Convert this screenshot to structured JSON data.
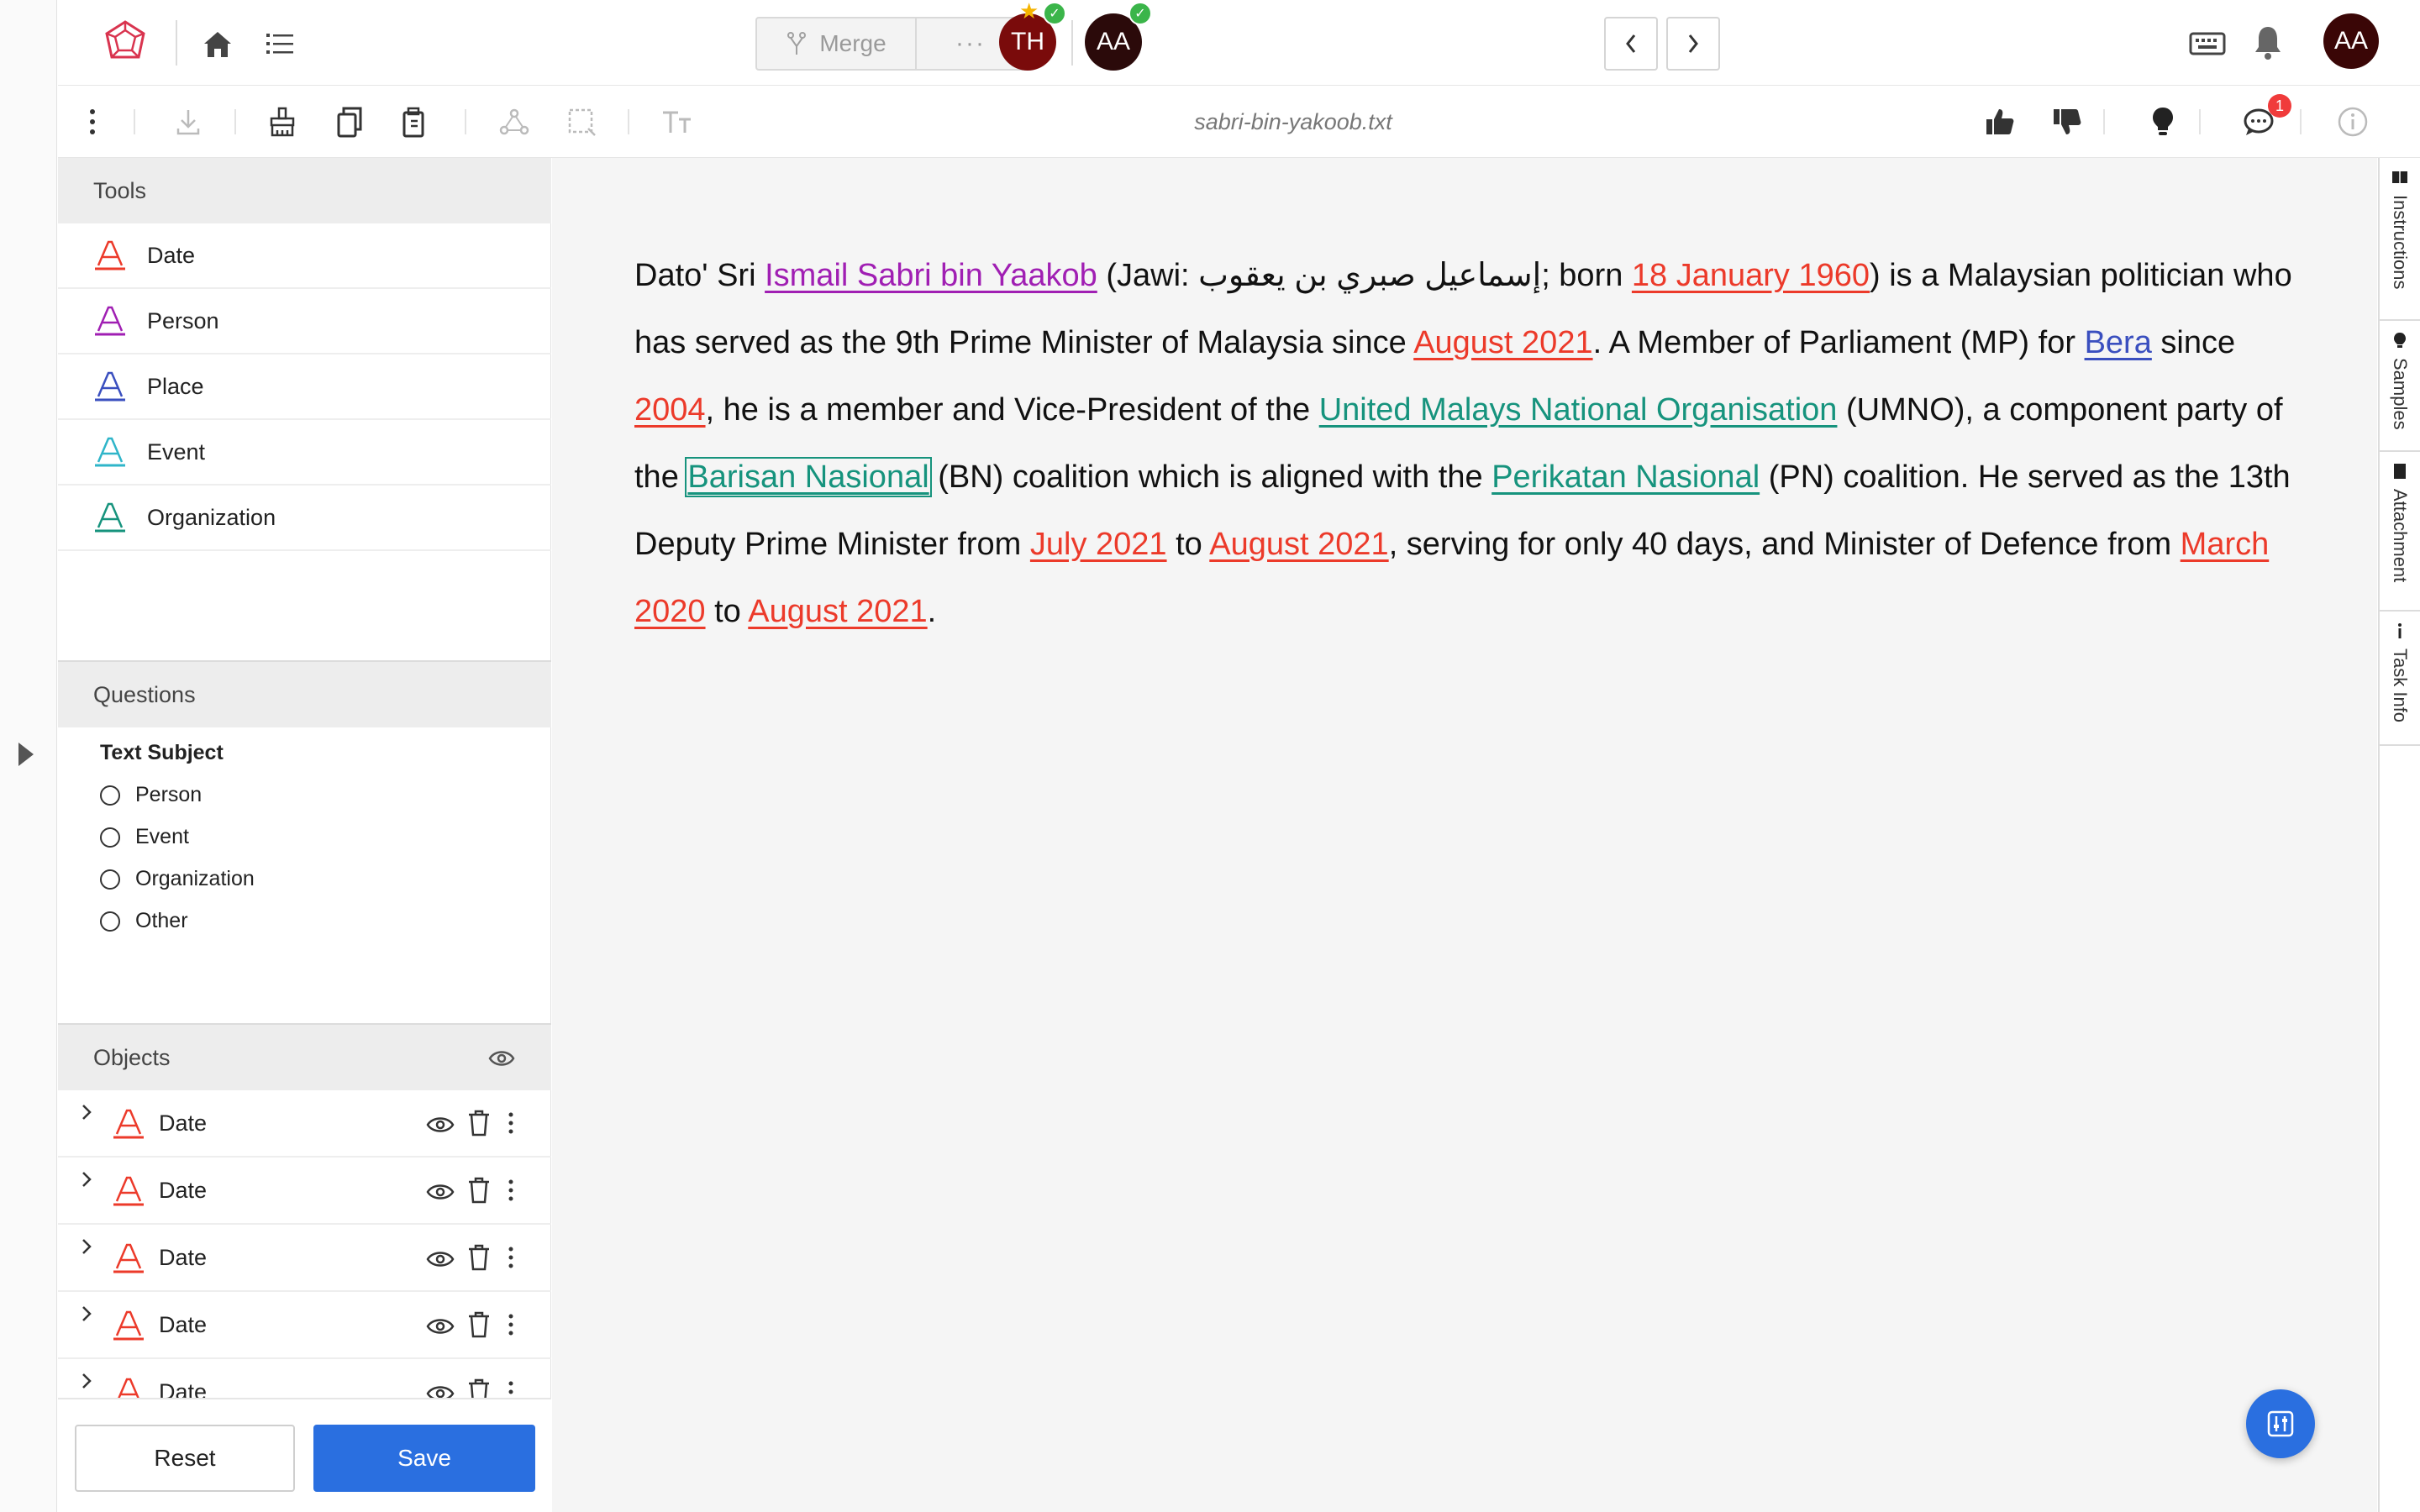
{
  "topbar": {
    "merge_label": "Merge",
    "merge_more": "···",
    "avatars": [
      "TH",
      "AA"
    ],
    "user_avatar": "AA"
  },
  "toolbar": {
    "filename": "sabri-bin-yakoob.txt",
    "comments_badge": "1"
  },
  "sidebar": {
    "tools_title": "Tools",
    "tools": [
      {
        "label": "Date",
        "color": "#ec3a2a"
      },
      {
        "label": "Person",
        "color": "#a01fb3"
      },
      {
        "label": "Place",
        "color": "#3a4fbf"
      },
      {
        "label": "Event",
        "color": "#2fb5c9"
      },
      {
        "label": "Organization",
        "color": "#16937d"
      }
    ],
    "questions_title": "Questions",
    "question": {
      "title": "Text Subject",
      "options": [
        "Person",
        "Event",
        "Organization",
        "Other"
      ]
    },
    "objects_title": "Objects",
    "objects": [
      {
        "label": "Date"
      },
      {
        "label": "Date"
      },
      {
        "label": "Date"
      },
      {
        "label": "Date"
      },
      {
        "label": "Date"
      }
    ],
    "reset_label": "Reset",
    "save_label": "Save"
  },
  "document": {
    "segments": [
      {
        "text": "Dato' Sri "
      },
      {
        "text": "Ismail Sabri bin Yaakob",
        "type": "person"
      },
      {
        "text": " (Jawi: إسماعيل صبري بن يعقوب; born "
      },
      {
        "text": "18 January 1960",
        "type": "date"
      },
      {
        "text": ") is a Malaysian politician who has served as the 9th Prime Minister of Malaysia since "
      },
      {
        "text": "August 2021",
        "type": "date"
      },
      {
        "text": ". A Member of Parliament (MP) for "
      },
      {
        "text": "Bera",
        "type": "place"
      },
      {
        "text": " since "
      },
      {
        "text": "2004",
        "type": "date"
      },
      {
        "text": ", he is a member and Vice-President of the "
      },
      {
        "text": "United Malays National Organisation",
        "type": "org"
      },
      {
        "text": " (UMNO), a component party of the "
      },
      {
        "text": "Barisan Nasional",
        "type": "org",
        "selected": true
      },
      {
        "text": " (BN) coalition which is aligned with the "
      },
      {
        "text": "Perikatan Nasional",
        "type": "org"
      },
      {
        "text": " (PN) coalition. He served as the 13th Deputy Prime Minister from "
      },
      {
        "text": "July 2021",
        "type": "date"
      },
      {
        "text": " to "
      },
      {
        "text": "August 2021",
        "type": "date"
      },
      {
        "text": ", serving for only 40 days, and Minister of Defence from "
      },
      {
        "text": "March 2020",
        "type": "date"
      },
      {
        "text": " to "
      },
      {
        "text": "August 2021",
        "type": "date"
      },
      {
        "text": "."
      }
    ]
  },
  "right_rail": {
    "tabs": [
      "Instructions",
      "Samples",
      "Attachment",
      "Task Info"
    ]
  },
  "colors": {
    "accent": "#2a6fe0",
    "date": "#ec3a2a",
    "person": "#a01fb3",
    "place": "#3a4fbf",
    "event": "#2fb5c9",
    "organization": "#16937d"
  }
}
